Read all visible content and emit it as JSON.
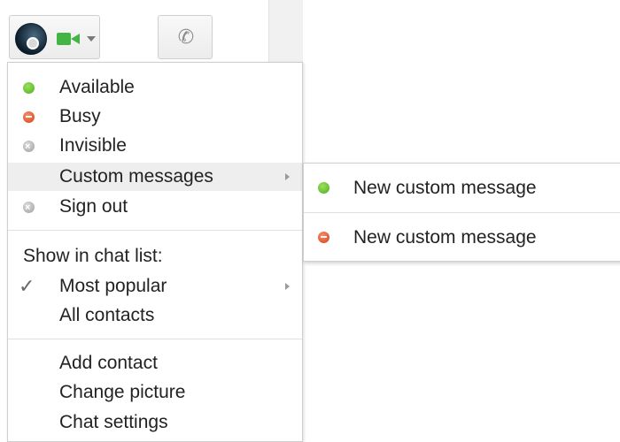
{
  "toolbar": {
    "status_button": {
      "icon": "avatar-status-icon"
    },
    "video_icon": "video-camera-icon",
    "call_icon": "phone-icon",
    "colors": {
      "video_green": "#44b544"
    }
  },
  "menu": {
    "status_items": [
      {
        "label": "Available",
        "status": "green"
      },
      {
        "label": "Busy",
        "status": "red"
      },
      {
        "label": "Invisible",
        "status": "gray"
      },
      {
        "label": "Custom messages",
        "has_submenu": true,
        "highlighted": true
      },
      {
        "label": "Sign out",
        "status": "gray"
      }
    ],
    "chat_list": {
      "heading": "Show in chat list:",
      "items": [
        {
          "label": "Most popular",
          "checked": true,
          "has_submenu": true
        },
        {
          "label": "All contacts"
        }
      ]
    },
    "actions": [
      {
        "label": "Add contact"
      },
      {
        "label": "Change picture"
      },
      {
        "label": "Chat settings"
      }
    ]
  },
  "submenu": {
    "items": [
      {
        "label": "New custom message",
        "status": "green"
      },
      {
        "label": "New custom message",
        "status": "red"
      }
    ]
  },
  "colors": {
    "available": "#4caf1e",
    "busy": "#d0451b",
    "invisible": "#9e9e9e",
    "highlight": "#eeeeee"
  }
}
